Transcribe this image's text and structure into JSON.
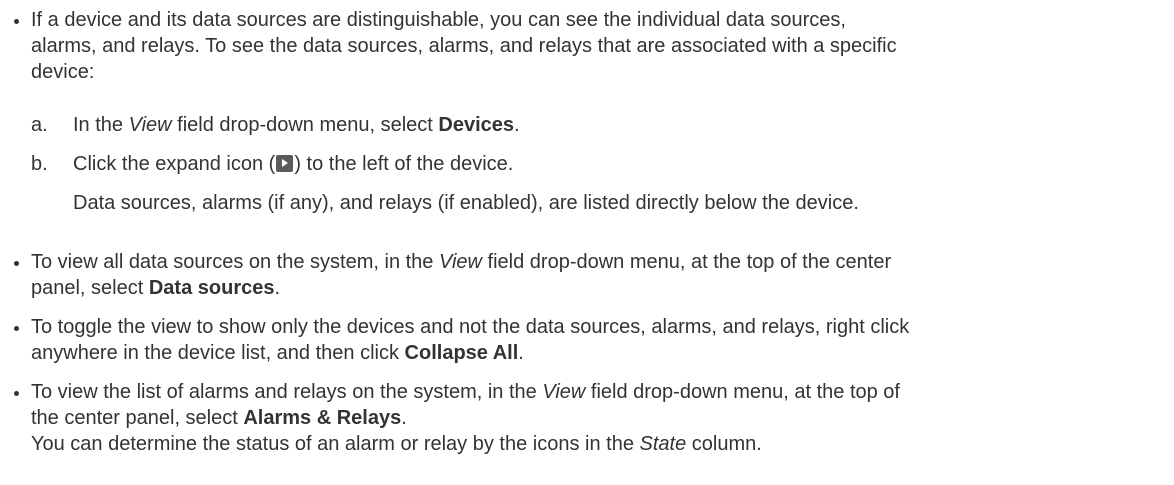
{
  "bullets": [
    {
      "lines": [
        [
          {
            "t": "If a device and its data sources are distinguishable, you can see the individual data sources,"
          }
        ],
        [
          {
            "t": "alarms, and relays. To see the data sources, alarms, and relays that are associated with a specific"
          }
        ],
        [
          {
            "t": "device:"
          }
        ]
      ]
    },
    {
      "lines": [
        [
          {
            "t": "To view all data sources on the system, in the "
          },
          {
            "t": "View",
            "s": "i"
          },
          {
            "t": " field drop-down menu, at the top of the center"
          }
        ],
        [
          {
            "t": "panel, select "
          },
          {
            "t": "Data sources",
            "s": "b"
          },
          {
            "t": "."
          }
        ]
      ]
    },
    {
      "lines": [
        [
          {
            "t": "To toggle the view to show only the devices and not the data sources, alarms, and relays, right click"
          }
        ],
        [
          {
            "t": "anywhere in the device list, and then click "
          },
          {
            "t": "Collapse All",
            "s": "b"
          },
          {
            "t": "."
          }
        ]
      ]
    },
    {
      "lines": [
        [
          {
            "t": "To view the list of alarms and relays on the system, in the "
          },
          {
            "t": "View",
            "s": "i"
          },
          {
            "t": " field drop-down menu, at the top of"
          }
        ],
        [
          {
            "t": "the center panel, select "
          },
          {
            "t": "Alarms & Relays",
            "s": "b"
          },
          {
            "t": "."
          }
        ],
        [
          {
            "t": "You can determine the status of an alarm or relay by the icons in the "
          },
          {
            "t": "State",
            "s": "i"
          },
          {
            "t": " column."
          }
        ]
      ]
    }
  ],
  "steps": [
    {
      "marker": "a.",
      "lines": [
        [
          {
            "t": "In the "
          },
          {
            "t": "View",
            "s": "i"
          },
          {
            "t": " field drop-down menu, select "
          },
          {
            "t": "Devices",
            "s": "b"
          },
          {
            "t": "."
          }
        ]
      ]
    },
    {
      "marker": "b.",
      "lines": [
        [
          {
            "t": "Click the expand icon ("
          },
          {
            "icon": "expand-icon"
          },
          {
            "t": ") to the left of the device."
          }
        ],
        [
          {
            "t": "Data sources, alarms (if any), and relays (if enabled), are listed directly below the device."
          }
        ]
      ]
    }
  ]
}
